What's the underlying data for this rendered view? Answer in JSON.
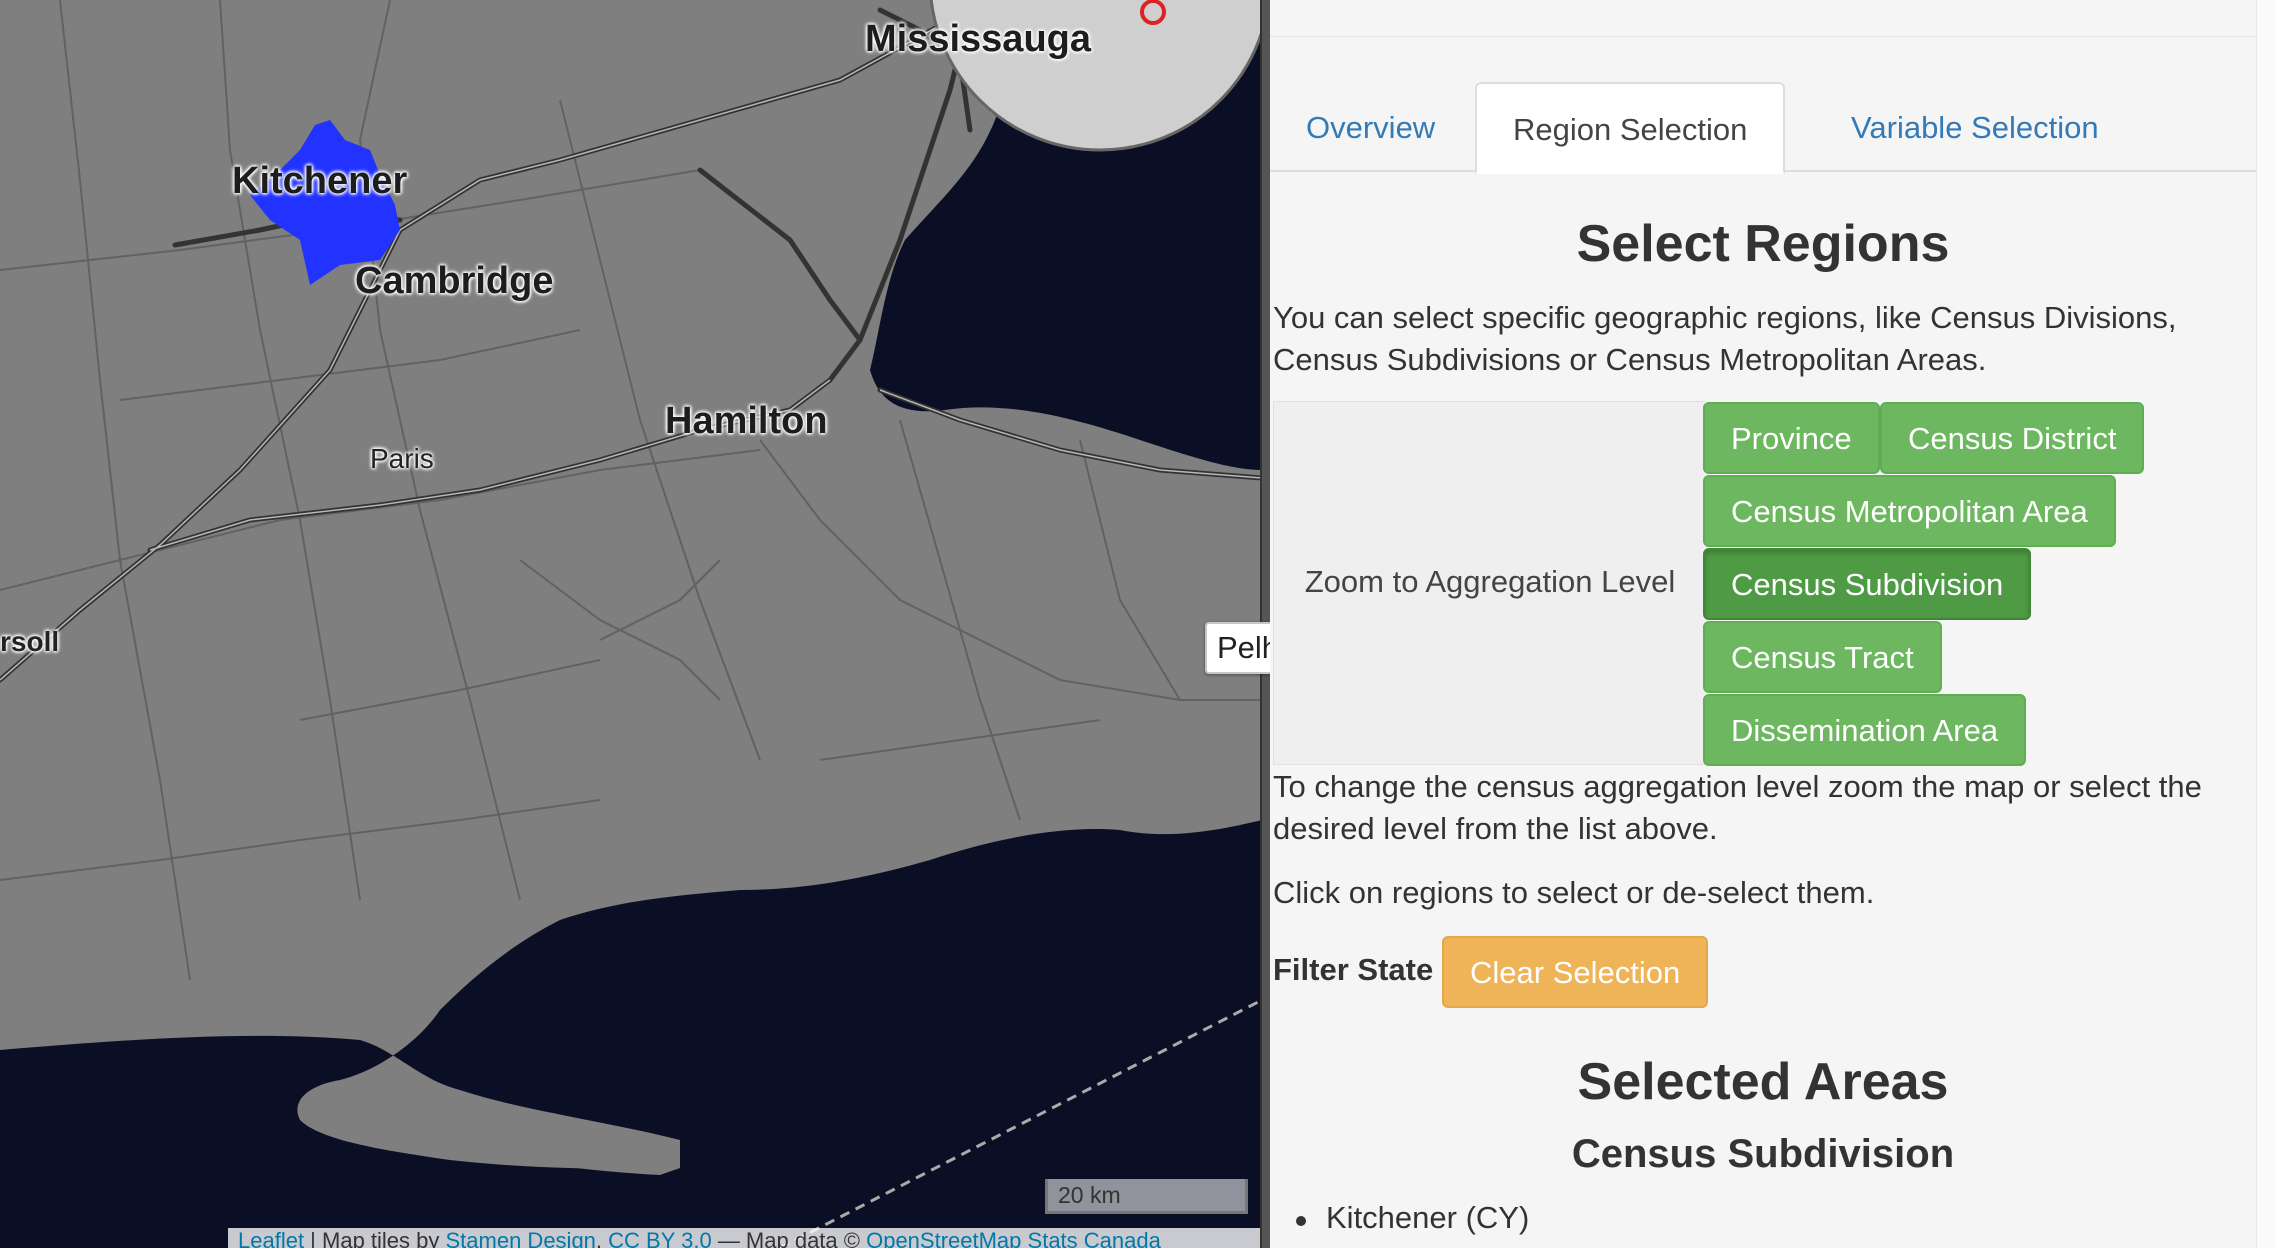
{
  "map": {
    "cities": {
      "mississauga": "Mississauga",
      "kitchener": "Kitchener",
      "cambridge": "Cambridge",
      "hamilton": "Hamilton",
      "paris": "Paris",
      "ingersoll_partial": "rsoll"
    },
    "tooltip": "Pelham (T) (CSD)",
    "scale": "20 km",
    "attribution": {
      "leaflet": "Leaflet",
      "sep1": " | Map tiles by ",
      "stamen": "Stamen Design",
      "sep2": ", ",
      "ccby": "CC BY 3.0",
      "sep3": " — Map data © ",
      "osm": "OpenStreetMap",
      "sep4": " ",
      "statcan": "Stats Canada"
    },
    "colors": {
      "land": "#7f7f7f",
      "water": "#0b0f25",
      "selected": "#2233ff"
    }
  },
  "tabs": [
    {
      "label": "Overview"
    },
    {
      "label": "Region Selection"
    },
    {
      "label": "Variable Selection"
    }
  ],
  "regions": {
    "title": "Select Regions",
    "intro": "You can select specific geographic regions, like Census Divisions, Census Subdivisions or Census Metropolitan Areas.",
    "zoom_label": "Zoom to Aggregation Level",
    "levels": {
      "province": "Province",
      "census_district": "Census District",
      "cma": "Census Metropolitan Area",
      "csd": "Census Subdivision",
      "ct": "Census Tract",
      "da": "Dissemination Area"
    },
    "active_level": "Census Subdivision",
    "change_text": "To change the census aggregation level zoom the map or select the desired level from the list above.",
    "click_text": "Click on regions to select or de-select them.",
    "filter_label": "Filter State",
    "clear_button": "Clear Selection"
  },
  "selected": {
    "title": "Selected Areas",
    "level_heading": "Census Subdivision",
    "items": [
      "Kitchener (CY)"
    ]
  },
  "colors": {
    "tab_link": "#337ab7",
    "btn_green": "#6cb75f",
    "btn_green_active": "#4e9a45",
    "btn_warning": "#eeb457"
  }
}
